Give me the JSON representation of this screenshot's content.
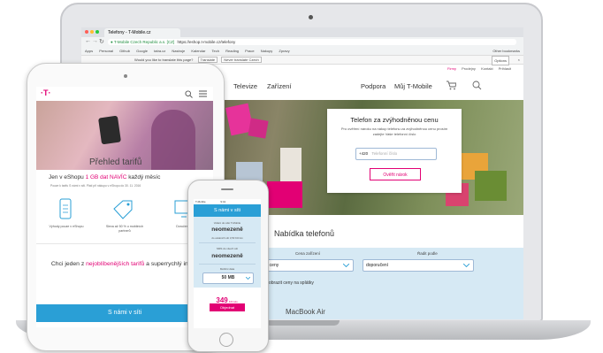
{
  "browser": {
    "tab_title": "Telefony - T-Mobile.cz",
    "security_label": "T-Mobile Czech Republic a.s. [CZ]",
    "url": "https://eshop.t-mobile.cz/telefony",
    "bookmarks": [
      "Apps",
      "Personal",
      "Github",
      "Google",
      "tatra.cz",
      "Nastroje",
      "Kalendar",
      "Tech",
      "Reading",
      "Prace",
      "Nakupy",
      "Zpravy"
    ],
    "bookmarks_more": "Other bookmarks",
    "translate_prompt": "Would you like to translate this page?",
    "translate_buttons": [
      "Translate",
      "Never translate Czech"
    ],
    "translate_options": "Options"
  },
  "site": {
    "top_links": [
      "Firmy",
      "Prodejny",
      "Kontakt",
      "Prihlasit"
    ],
    "nav": [
      "Televize",
      "Zařízení"
    ],
    "nav_right": [
      "Podpora",
      "Můj T-Mobile"
    ]
  },
  "callback": {
    "title": "Telefon za zvýhodněnou cenu",
    "text": "Pro ověření nároku na nákup telefonu za zvýhodněnou cenu prosím zadejte Vaše telefonní číslo",
    "prefix": "+420",
    "placeholder": "Telefonní číslo",
    "button": "Ověřit nárok"
  },
  "offer": {
    "heading": "Nabídka telefonů",
    "filter1_label": "Cena zařízení",
    "filter1_value": "ny ceny",
    "filter2_label": "Řadit podle",
    "filter2_value": "doporučení",
    "installments": "obrazit ceny na splátky"
  },
  "macbook": {
    "label": "MacBook Air"
  },
  "ipad": {
    "banner_title": "Přehled tarifů",
    "promo_pre": "Jen v eShopu ",
    "promo_highlight": "1 GB dat NAVÍC",
    "promo_post": " každý měsíc",
    "fine_print": "Pouze k tarifu S námi v síti. Platí při nákupu v eShopu do 30. 11. 2016",
    "features": [
      "Výhody pouze v eShopu",
      "Sleva až 50 % u mobilních partnerů",
      "Doručení zdarma"
    ],
    "choose_pre": "Chci jeden z ",
    "choose_link": "nejoblíbenějších tarifů",
    "choose_post": " a superrychlý internet",
    "cta": "S námi v síti"
  },
  "iphone": {
    "status_left": "T-Mobile",
    "status_time": "9:41",
    "header": "S námi v síti",
    "row1_label": "Volání do sítě T-Mobile",
    "row1_value": "neomezeně",
    "row1_note": "do ostatních sítí 3,50 Kč/min",
    "row2_label": "SMS do všech sítí",
    "row2_value": "neomezeně",
    "data_label": "Mobilní data",
    "data_value": "50 MB",
    "price": "349",
    "price_unit": "Kč/měs.",
    "order": "Objednat"
  },
  "colors": {
    "brand": "#e20074",
    "accent_blue": "#2a9fd6"
  }
}
